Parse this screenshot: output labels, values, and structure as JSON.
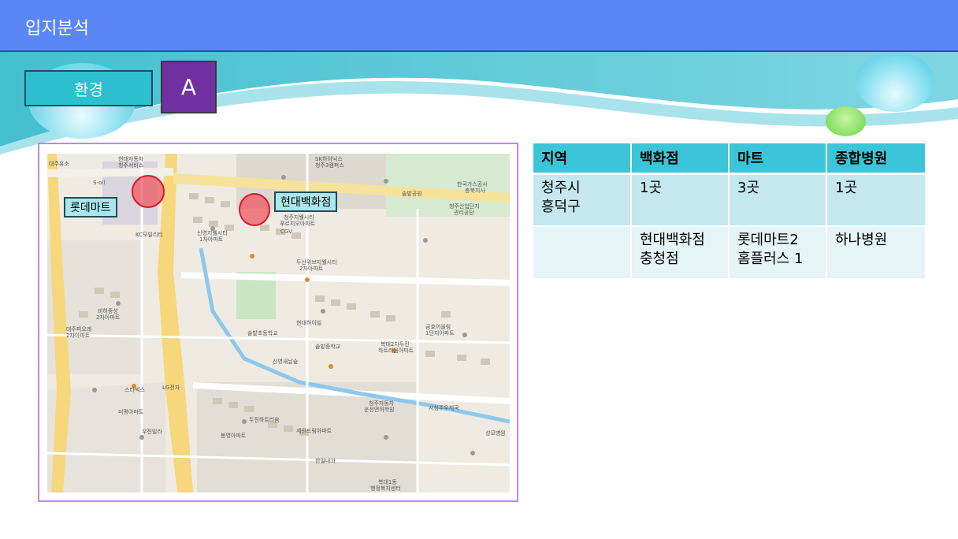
{
  "header": {
    "title": "입지분석"
  },
  "tags": {
    "environment": "환경",
    "option": "A"
  },
  "map": {
    "callouts": {
      "lotte": "롯데마트",
      "hyundai": "현대백화점"
    },
    "labels": [
      "현대자동차",
      "청주서비스",
      "SK하이닉스",
      "청주3캠퍼스",
      "S-oil",
      "롯데마트",
      "KC모빌리티",
      "신영지웰시티",
      "1차아파트",
      "CGV",
      "청주지웰시티",
      "푸르지오아파트",
      "두산위브지웰시티",
      "2차아파트",
      "솔밭공원",
      "한국가스공사",
      "충북지사",
      "청주산업단지",
      "관리공단",
      "비하중성",
      "2차아파트",
      "대주피오레",
      "2차아파트",
      "솔밭초등학교",
      "현대하이빌",
      "금호어울림",
      "1단지아파트",
      "복대2차두진",
      "하트리움아파트",
      "솔밭중학교",
      "신영새날숲",
      "스타벅스",
      "LG전자",
      "미평아파트",
      "우진빌라",
      "봉명아파트",
      "하나병원",
      "서청주우체국",
      "성모병원",
      "청주자동차",
      "운전면허학원",
      "세원드림아파트",
      "두진하트리움",
      "복대1동",
      "행정복지센터",
      "한일내과",
      "대주유소"
    ]
  },
  "table": {
    "headers": [
      "지역",
      "백화점",
      "마트",
      "종합병원"
    ],
    "rows": [
      [
        "청주시\n흥덕구",
        "1곳",
        "3곳",
        "1곳"
      ],
      [
        "",
        "현대백화점\n충청점",
        "롯데마트2\n홈플러스 1",
        "하나병원"
      ]
    ]
  },
  "colors": {
    "title_bar": "#5b86f6",
    "accent": "#3cc5d9",
    "purple": "#7030a0"
  }
}
